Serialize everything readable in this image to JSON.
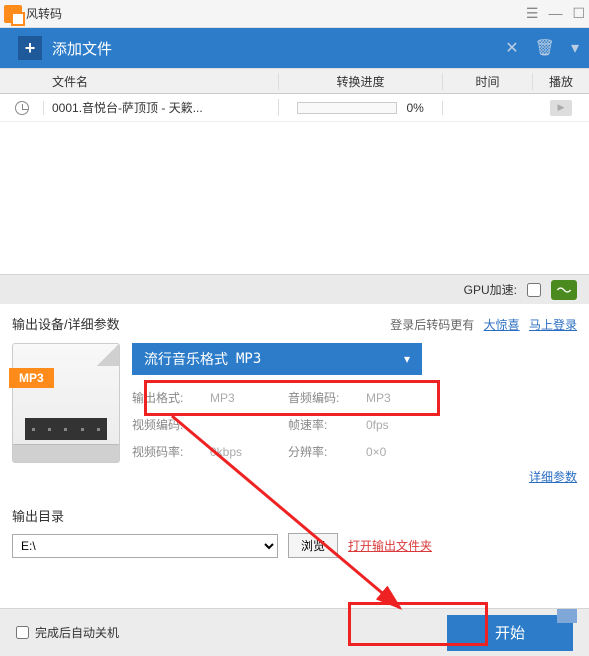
{
  "window": {
    "title": "风转码"
  },
  "topbar": {
    "add_label": "添加文件"
  },
  "columns": {
    "name": "文件名",
    "progress": "转换进度",
    "time": "时间",
    "play": "播放"
  },
  "files": [
    {
      "name": "0001.音悦台-萨顶顶 - 天簌...",
      "progress_pct": "0%"
    }
  ],
  "gpu": {
    "label": "GPU加速:"
  },
  "output_settings": {
    "header": "输出设备/详细参数",
    "login_prefix": "登录后转码更有",
    "surprise": "大惊喜",
    "login_link": "马上登录",
    "format_title": "流行音乐格式",
    "format_code": "MP3",
    "badge": "MP3",
    "params": {
      "out_fmt_lbl": "输出格式:",
      "out_fmt_val": "MP3",
      "aenc_lbl": "音频编码:",
      "aenc_val": "MP3",
      "venc_lbl": "视频编码:",
      "venc_val": "",
      "fps_lbl": "帧速率:",
      "fps_val": "0fps",
      "vbr_lbl": "视频码率:",
      "vbr_val": "0kbps",
      "res_lbl": "分辨率:",
      "res_val": "0×0"
    },
    "detail_link": "详细参数"
  },
  "output_dir": {
    "header": "输出目录",
    "path": "E:\\",
    "browse": "浏览",
    "open_link": "打开输出文件夹"
  },
  "footer": {
    "shutdown": "完成后自动关机",
    "start": "开始"
  }
}
